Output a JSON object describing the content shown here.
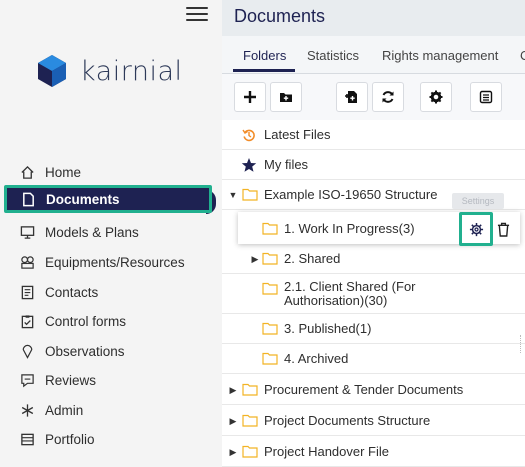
{
  "app": {
    "logo_text": "kairnial",
    "brand_color": "#1e2252",
    "accent_color": "#21b08f"
  },
  "sidebar": {
    "items": [
      {
        "label": "Home",
        "icon": "home-icon"
      },
      {
        "label": "Documents",
        "icon": "document-icon",
        "active": true
      },
      {
        "label": "Models & Plans",
        "icon": "monitor-icon"
      },
      {
        "label": "Equipments/Resources",
        "icon": "equipment-icon"
      },
      {
        "label": "Contacts",
        "icon": "contacts-icon"
      },
      {
        "label": "Control forms",
        "icon": "clipboard-icon"
      },
      {
        "label": "Observations",
        "icon": "pin-icon"
      },
      {
        "label": "Reviews",
        "icon": "review-icon"
      },
      {
        "label": "Admin",
        "icon": "asterisk-icon"
      },
      {
        "label": "Portfolio",
        "icon": "portfolio-icon"
      }
    ]
  },
  "main": {
    "title": "Documents",
    "tabs": [
      {
        "label": "Folders",
        "active": true
      },
      {
        "label": "Statistics"
      },
      {
        "label": "Rights management"
      },
      {
        "label": "C"
      }
    ],
    "toolbar": [
      "add-icon",
      "add-folder-icon",
      "add-file-icon",
      "refresh-icon",
      "settings-icon",
      "list-icon"
    ],
    "tree": [
      {
        "label": "Latest Files",
        "icon": "history-icon"
      },
      {
        "label": "My files",
        "icon": "star-icon"
      },
      {
        "label": "Example ISO-19650 Structure",
        "caret": "down"
      },
      {
        "label": "1. Work In Progress(3)",
        "selected": true
      },
      {
        "label": "2. Shared",
        "caret": "right"
      },
      {
        "label": "2.1. Client Shared (For Authorisation)(30)"
      },
      {
        "label": "3. Published(1)"
      },
      {
        "label": "4. Archived"
      },
      {
        "label": "Procurement & Tender Documents",
        "caret": "right"
      },
      {
        "label": "Project Documents Structure",
        "caret": "right"
      },
      {
        "label": "Project Handover File",
        "caret": "right"
      }
    ],
    "tooltip": "Settings"
  }
}
